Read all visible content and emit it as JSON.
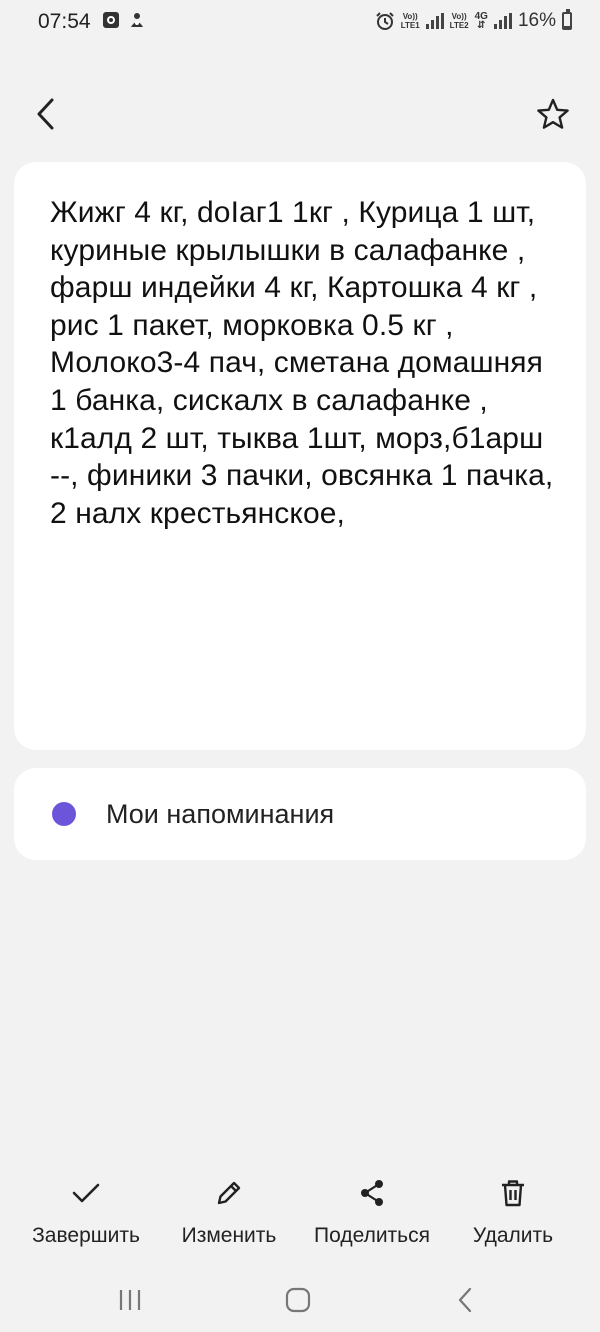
{
  "status_bar": {
    "time": "07:54",
    "sim1_label_top": "Vo))",
    "sim1_label_bottom": "LTE1",
    "sim2_label_top": "Vo))",
    "sim2_label_bottom": "LTE2",
    "network_type": "4G",
    "battery": "16%"
  },
  "note": {
    "text": "Жижг 4 кг, doIаг1 1кг , Курица 1 шт, куриные крылышки в салафанке , фарш индейки 4 кг, Картошка 4 кг , рис 1 пакет, морковка 0.5 кг , Молоко3-4 пач, сметана домашняя 1 банка, сискалх в салафанке , к1алд 2 шт, тыква 1шт, морз,б1арш --, финики 3 пачки, овсянка 1 пачка, 2 налх крестьянское,"
  },
  "reminder": {
    "label": "Мои напоминания",
    "dot_color": "#6c55d9"
  },
  "actions": {
    "complete": "Завершить",
    "edit": "Изменить",
    "share": "Поделиться",
    "delete": "Удалить"
  },
  "icons": {
    "back": "chevron-left-icon",
    "favorite": "star-outline-icon",
    "complete": "checkmark-icon",
    "edit": "pencil-icon",
    "share": "share-icon",
    "delete": "trash-icon"
  }
}
